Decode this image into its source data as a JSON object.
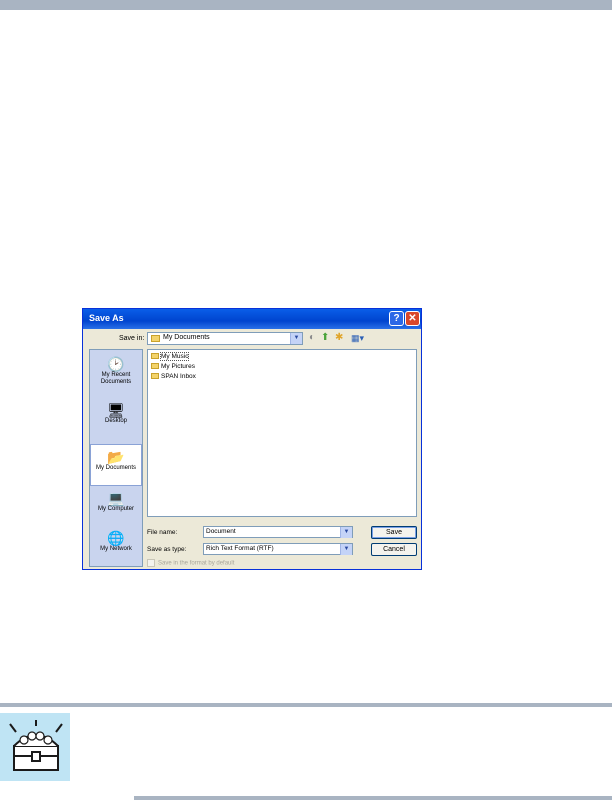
{
  "dialog": {
    "title": "Save As",
    "help_glyph": "?",
    "close_glyph": "✕",
    "save_in_label": "Save in:",
    "save_in_value": "My Documents",
    "places": [
      {
        "label": "My Recent Documents",
        "icon": "recent-documents-icon",
        "glyph": "🕑"
      },
      {
        "label": "Desktop",
        "icon": "desktop-icon",
        "glyph": "🖥"
      },
      {
        "label": "My Documents",
        "icon": "my-documents-icon",
        "glyph": "📂"
      },
      {
        "label": "My Computer",
        "icon": "my-computer-icon",
        "glyph": "💻"
      },
      {
        "label": "My Network",
        "icon": "my-network-icon",
        "glyph": "🌐"
      }
    ],
    "files": [
      {
        "name": "My Music"
      },
      {
        "name": "My Pictures"
      },
      {
        "name": "SPAN Inbox"
      }
    ],
    "file_name_label": "File name:",
    "file_name_value": "Document",
    "save_as_type_label": "Save as type:",
    "save_as_type_value": "Rich Text Format (RTF)",
    "save_button": "Save",
    "cancel_button": "Cancel",
    "checkbox_label": "Save in the format by default"
  },
  "colors": {
    "titlebar": "#0a5ee8",
    "dialog_bg": "#ece9d8",
    "places_bar": "#c9d4ee",
    "rule": "#a9b4c2",
    "hint_bg": "#bfe4f4"
  }
}
